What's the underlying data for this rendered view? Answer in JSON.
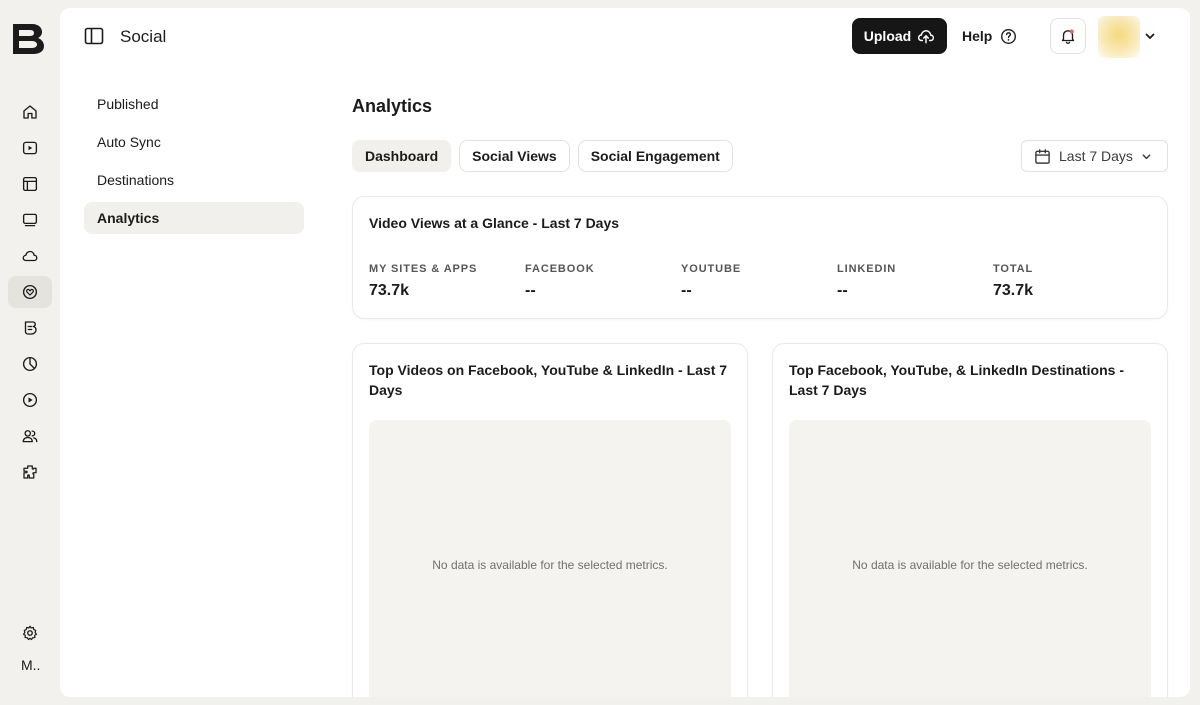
{
  "rail": {
    "logo": "B",
    "items": [
      {
        "icon": "home-icon"
      },
      {
        "icon": "video-play-icon"
      },
      {
        "icon": "library-icon"
      },
      {
        "icon": "player-icon"
      },
      {
        "icon": "cloud-icon"
      },
      {
        "icon": "social-heart-icon",
        "active": true
      },
      {
        "icon": "brand-icon"
      },
      {
        "icon": "analytics-pie-icon"
      },
      {
        "icon": "live-play-icon"
      },
      {
        "icon": "users-icon"
      },
      {
        "icon": "integrations-icon"
      }
    ],
    "settings_icon": "gear-icon",
    "user_initial": "M.."
  },
  "header": {
    "title": "Social",
    "upload_label": "Upload",
    "help_label": "Help"
  },
  "subnav": {
    "items": [
      {
        "label": "Published"
      },
      {
        "label": "Auto Sync"
      },
      {
        "label": "Destinations"
      },
      {
        "label": "Analytics",
        "active": true
      }
    ]
  },
  "main": {
    "title": "Analytics",
    "tabs": [
      {
        "label": "Dashboard",
        "active": true
      },
      {
        "label": "Social Views"
      },
      {
        "label": "Social Engagement"
      }
    ],
    "date_range": "Last 7 Days",
    "glance": {
      "title": "Video Views at a Glance - Last 7 Days",
      "stats": [
        {
          "label": "MY SITES & APPS",
          "value": "73.7k"
        },
        {
          "label": "FACEBOOK",
          "value": "--"
        },
        {
          "label": "YOUTUBE",
          "value": "--"
        },
        {
          "label": "LINKEDIN",
          "value": "--"
        },
        {
          "label": "TOTAL",
          "value": "73.7k"
        }
      ]
    },
    "top_videos": {
      "title": "Top Videos on Facebook, YouTube & LinkedIn - Last 7 Days",
      "empty_text": "No data is available for the selected metrics."
    },
    "top_destinations": {
      "title": "Top Facebook, YouTube, & LinkedIn Destinations - Last 7 Days",
      "empty_text": "No data is available for the selected metrics."
    }
  },
  "colors": {
    "background": "#f2f1ee",
    "panel": "#ffffff",
    "primary_button": "#161616",
    "active_tab": "#f1f0ec"
  }
}
